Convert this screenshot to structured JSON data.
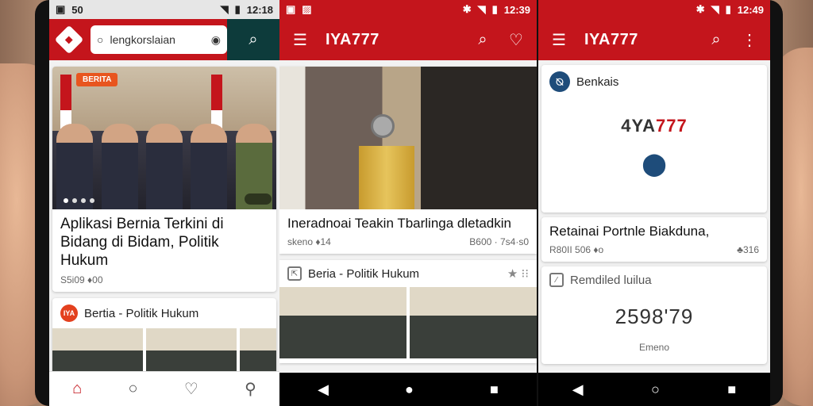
{
  "colors": {
    "accent": "#c4151c",
    "brand_dark": "#0d3b3b"
  },
  "screen1": {
    "status_time": "50",
    "status_right": "12:18",
    "search_placeholder": "lengkorslaian",
    "badge": "BERITA",
    "headline": "Aplikasi Bernia Terkini di Bidang di Bidam, Politik Hukum",
    "meta_left": "S5i09 ♦00",
    "section_title": "Bertia - Politik Hukum",
    "section_logo": "IYA",
    "nav_icons": [
      "home-icon",
      "search-icon",
      "heart-icon",
      "user-icon"
    ]
  },
  "screen2": {
    "status_time": "12:39",
    "title": "IYA777",
    "headline": "Ineradnoai Teakin Tbarlinga dletadkin",
    "meta_left": "skeno ♦14",
    "meta_right": "B600 · 7s4·s0",
    "section_title": "Beria - Politik Hukum",
    "section_right": "★ ⁝⁝"
  },
  "screen3": {
    "status_time": "12:49",
    "title": "IYA777",
    "brand_label": "Benkais",
    "logo_text_main": "4YA",
    "logo_text_accent": "777",
    "headline": "Retainai Portnle Biakduna,",
    "meta_left": "R80II 506 ♦o",
    "meta_right": "♣316",
    "section_title": "Remdiled luilua",
    "bignum": "2598'79",
    "caption": "Emeno"
  }
}
